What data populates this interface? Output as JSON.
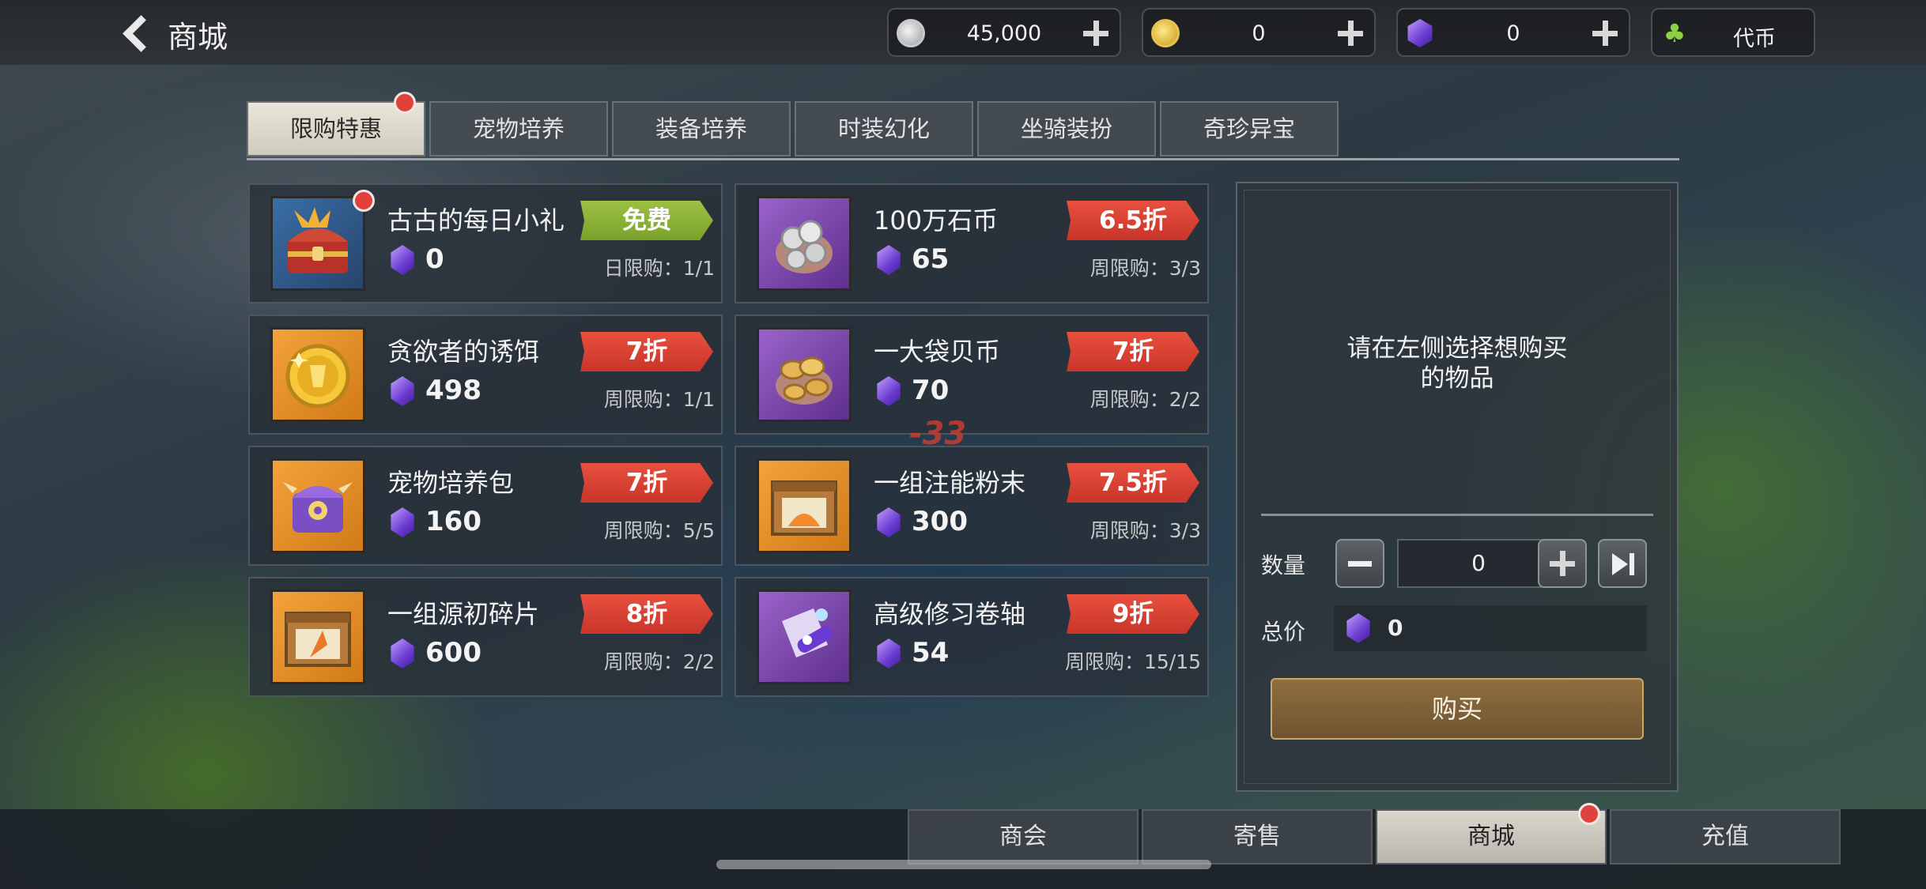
{
  "header": {
    "title": "商城"
  },
  "currencies": [
    {
      "icon": "silver-coin-icon",
      "value": "45,000"
    },
    {
      "icon": "gold-coin-icon",
      "value": "0"
    },
    {
      "icon": "purple-gem-icon",
      "value": "0"
    }
  ],
  "token": {
    "icon": "sprout-icon",
    "label": "代币"
  },
  "tabs": [
    "限购特惠",
    "宠物培养",
    "装备培养",
    "时装幻化",
    "坐骑装扮",
    "奇珍异宝"
  ],
  "items": [
    {
      "name": "古古的每日小礼",
      "price": "0",
      "badge": "免费",
      "limit": "日限购：1/1",
      "icon": "treasure-chest-icon"
    },
    {
      "name": "100万石币",
      "price": "65",
      "badge": "6.5折",
      "limit": "周限购：3/3",
      "icon": "silver-coin-bag-icon"
    },
    {
      "name": "贪欲者的诱饵",
      "price": "498",
      "badge": "7折",
      "limit": "周限购：1/1",
      "icon": "gold-medal-icon"
    },
    {
      "name": "一大袋贝币",
      "price": "70",
      "badge": "7折",
      "limit": "周限购：2/2",
      "icon": "gold-coin-bag-icon"
    },
    {
      "name": "宠物培养包",
      "price": "160",
      "badge": "7折",
      "limit": "周限购：5/5",
      "icon": "pet-pack-icon"
    },
    {
      "name": "一组注能粉末",
      "price": "300",
      "badge": "7.5折",
      "limit": "周限购：3/3",
      "icon": "powder-crate-icon"
    },
    {
      "name": "一组源初碎片",
      "price": "600",
      "badge": "8折",
      "limit": "周限购：2/2",
      "icon": "shard-crate-icon"
    },
    {
      "name": "高级修习卷轴",
      "price": "54",
      "badge": "9折",
      "limit": "周限购：15/15",
      "icon": "scroll-icon"
    }
  ],
  "detail": {
    "hint_line1": "请在左侧选择想购买",
    "hint_line2": "的物品",
    "qty_label": "数量",
    "qty_value": "0",
    "total_label": "总价",
    "total_value": "0",
    "buy_label": "购买"
  },
  "bottom_tabs": [
    "商会",
    "寄售",
    "商城",
    "充值"
  ],
  "effect_text": "-33",
  "colors": {
    "discount_red": "#d83d30",
    "free_green": "#8bb236",
    "buy_brown": "#7e6236",
    "notify_red": "#e0413b"
  }
}
